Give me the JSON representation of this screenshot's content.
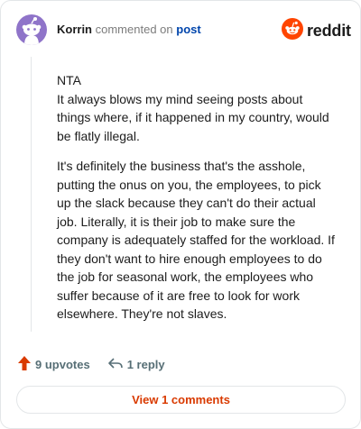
{
  "header": {
    "username": "Korrin",
    "commented_text": "commented on",
    "post_link": "post",
    "brand": "reddit"
  },
  "comment": {
    "paragraphs": [
      "NTA",
      "It always blows my mind seeing posts about things where, if it happened in my country, would be flatly illegal.",
      "It's definitely the business that's the asshole, putting the onus on you, the employees, to pick up the slack because they can't do their actual job. Literally, it is their job to make sure the company is adequately staffed for the workload. If they don't want to hire enough employees to do the job for seasonal work, the employees who suffer because of it are free to look for work elsewhere. They're not slaves."
    ]
  },
  "actions": {
    "upvotes": "9 upvotes",
    "replies": "1 reply"
  },
  "view_comments": "View 1 comments",
  "colors": {
    "brand_orange": "#ff4500",
    "upvote": "#d93a00",
    "link": "#0045ac",
    "avatar_bg": "#8f74c9"
  },
  "icons": {
    "avatar": "snoo-avatar-icon",
    "brand": "reddit-logo-icon",
    "upvote": "upvote-arrow-icon",
    "reply": "reply-arrow-icon"
  }
}
